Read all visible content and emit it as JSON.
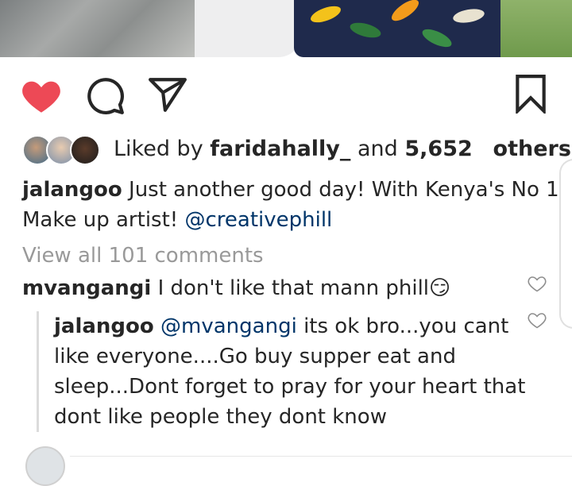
{
  "post": {
    "likes": {
      "prefix": "Liked by",
      "first_user": "faridahally_",
      "and": "and",
      "count": "5,652",
      "suffix": "others"
    },
    "caption": {
      "username": "jalangoo",
      "text": "Just another good day! With Kenya's No 1 Make up artist!",
      "mention": "@creativephill"
    },
    "view_all": "View all 101 comments",
    "comments": [
      {
        "username": "mvangangi",
        "text": "I don't like that mann phill",
        "emoji": "😏"
      },
      {
        "username": "jalangoo",
        "mention": "@mvangangi",
        "text": "its ok bro...you cant like everyone....Go buy supper eat and sleep...Dont forget to pray for your heart that dont like people they dont know"
      }
    ]
  },
  "icons": {
    "like": "heart-filled-icon",
    "comment": "comment-bubble-icon",
    "share": "paper-plane-icon",
    "save": "bookmark-icon",
    "comment_like": "heart-outline-icon"
  },
  "colors": {
    "like_red": "#ed4956",
    "mention_blue": "#003569",
    "muted_gray": "#999999",
    "text": "#262626"
  }
}
